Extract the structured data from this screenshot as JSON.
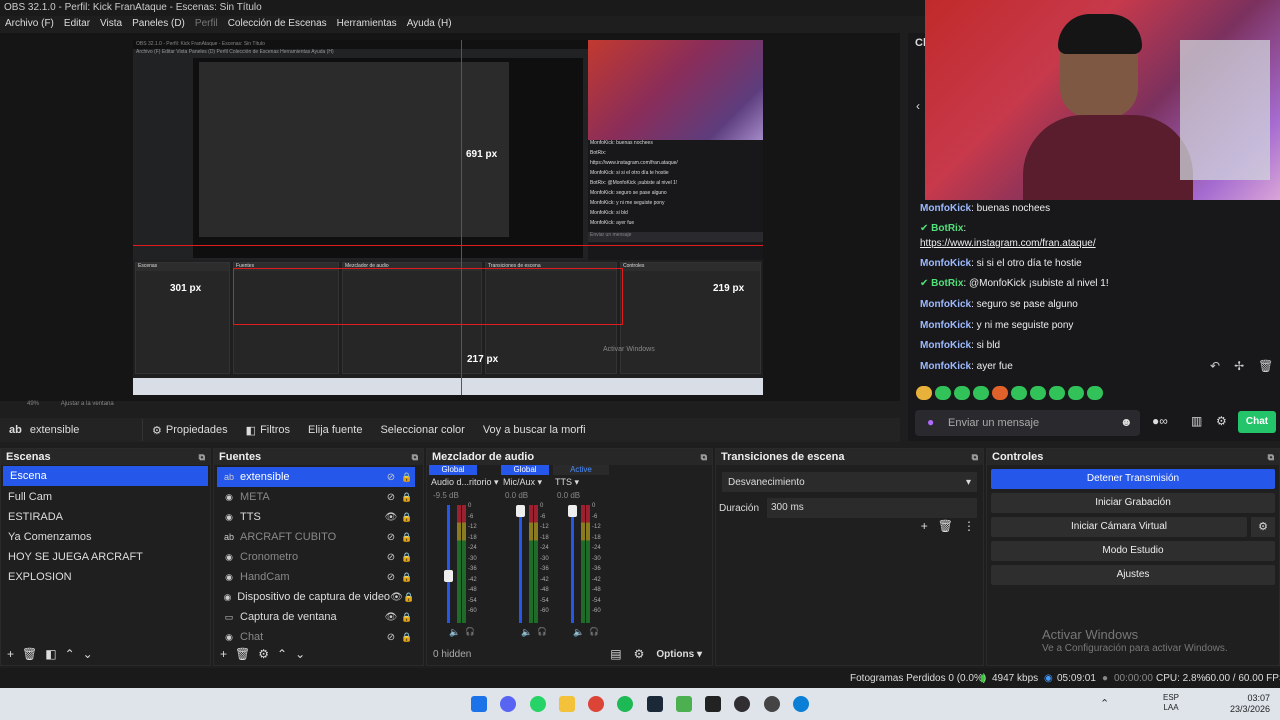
{
  "window": {
    "title": "OBS 32.1.0 - Perfil: Kick FranAtaque - Escenas: Sin Título"
  },
  "menu": [
    "Archivo (F)",
    "Editar",
    "Vista",
    "Paneles (D)",
    "Perfil",
    "Colección de Escenas",
    "Herramientas",
    "Ayuda (H)"
  ],
  "preview": {
    "zoom_label": "49%",
    "fit_label": "Ajustar a la ventana",
    "measures": [
      "691 px",
      "301 px",
      "219 px",
      "217 px"
    ]
  },
  "nested": {
    "title": "OBS 32.1.0 - Perfil: Kick FranAtaque - Escenas: Sin Título",
    "menu": "Archivo (F)   Editar   Vista   Paneles (D)   Perfil   Colección de Escenas   Herramientas   Ayuda (H)",
    "chat": [
      "MonfoKick: buenas nochees",
      "BotRix:",
      "https://www.instagram.com/fran.ataque/",
      "MonfoKick: si si el otro día te hostie",
      "BotRix: @MonfoKick ¡subiste al nivel 1!",
      "MonfoKick: seguro se pase alguno",
      "MonfoKick: y ni me seguiste pony",
      "MonfoKick: si bld",
      "MonfoKick: ayer fue"
    ],
    "input_placeholder": "Enviar un mensaje"
  },
  "toolbar": {
    "selected": "extensible",
    "props": "Propiedades",
    "filters": "Filtros",
    "b1": "Elija fuente",
    "b2": "Seleccionar color",
    "b3": "Voy a buscar la morfi"
  },
  "scenes": {
    "title": "Escenas",
    "items": [
      "Escena",
      "Full Cam",
      "ESTIRADA",
      "Ya Comenzamos",
      "HOY SE JUEGA ARCRAFT",
      "EXPLOSION"
    ],
    "selected": 0
  },
  "sources": {
    "title": "Fuentes",
    "items": [
      {
        "name": "extensible",
        "icon": "text-icon",
        "visible": false,
        "selected": true
      },
      {
        "name": "META",
        "icon": "media-icon",
        "visible": false
      },
      {
        "name": "TTS",
        "icon": "media-icon",
        "visible": true
      },
      {
        "name": "ARCRAFT CUBITO",
        "icon": "text-icon",
        "visible": false
      },
      {
        "name": "Cronometro",
        "icon": "media-icon",
        "visible": false
      },
      {
        "name": "HandCam",
        "icon": "media-icon",
        "visible": false
      },
      {
        "name": "Dispositivo de captura de video",
        "icon": "camera-icon",
        "visible": true
      },
      {
        "name": "Captura de ventana",
        "icon": "window-icon",
        "visible": true
      },
      {
        "name": "Chat",
        "icon": "media-icon",
        "visible": false
      }
    ]
  },
  "mixer": {
    "title": "Mezclador de audio",
    "channels": [
      {
        "tag": "Global",
        "name": "Audio d...ritorio",
        "db": "-9.5 dB",
        "level": 0.35
      },
      {
        "tag": "Global",
        "name": "Mic/Aux",
        "db": "0.0 dB",
        "level": 1.0
      },
      {
        "tag": "Active",
        "name": "TTS",
        "db": "0.0 dB",
        "level": 1.0
      }
    ],
    "scale": [
      "0",
      "-6",
      "-12",
      "-18",
      "-24",
      "-30",
      "-36",
      "-42",
      "-48",
      "-54",
      "-60"
    ],
    "hidden": "0 hidden",
    "options": "Options"
  },
  "transitions": {
    "title": "Transiciones de escena",
    "type": "Desvanecimiento",
    "duration_label": "Duración",
    "duration": "300 ms"
  },
  "controls": {
    "title": "Controles",
    "buttons": [
      "Detener Transmisión",
      "Iniciar Grabación",
      "Iniciar Cámara Virtual",
      "Modo Estudio",
      "Ajustes"
    ]
  },
  "chat": {
    "tab": "Ch",
    "lines": [
      {
        "user": "MonfoKick",
        "text": "buenas nochees",
        "type": "user"
      },
      {
        "user": "BotRix",
        "text": "",
        "type": "bot"
      },
      {
        "user": "",
        "text": "https://www.instagram.com/fran.ataque/",
        "type": "link"
      },
      {
        "user": "MonfoKick",
        "text": "si si el otro día te hostie",
        "type": "user"
      },
      {
        "user": "BotRix",
        "text": "@MonfoKick ¡subiste al nivel 1!",
        "type": "bot"
      },
      {
        "user": "MonfoKick",
        "text": "seguro se pase alguno",
        "type": "user"
      },
      {
        "user": "MonfoKick",
        "text": "y ni me seguiste pony",
        "type": "user"
      },
      {
        "user": "MonfoKick",
        "text": "si bld",
        "type": "user"
      },
      {
        "user": "MonfoKick",
        "text": "ayer fue",
        "type": "user"
      }
    ],
    "placeholder": "Enviar un mensaje",
    "send": "Chat"
  },
  "status": {
    "dropped": "Fotogramas Perdidos 0 (0.0%)",
    "kbps": "4947 kbps",
    "live": "05:09:01",
    "rec": "00:00:00",
    "cpu": "CPU: 2.8%",
    "fps": "60.00 / 60.00 FPS"
  },
  "watermark": {
    "title": "Activar Windows",
    "sub": "Ve a Configuración para activar Windows."
  },
  "taskbar": {
    "lang1": "ESP",
    "lang2": "LAA",
    "time": "03:07",
    "date": "23/3/2026"
  }
}
